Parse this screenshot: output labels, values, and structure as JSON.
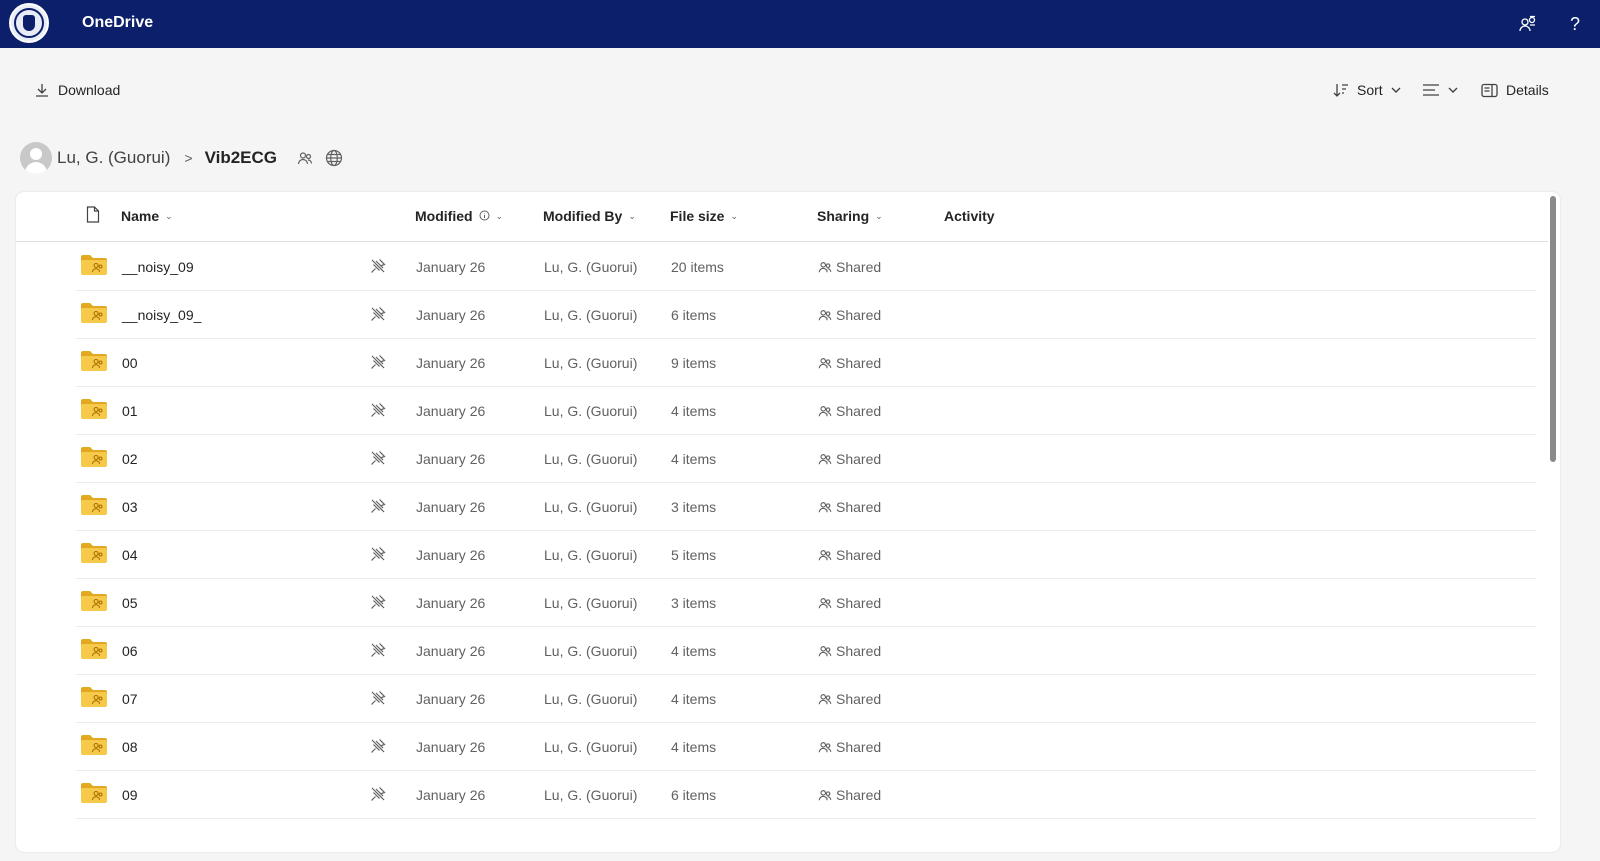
{
  "app": {
    "title": "OneDrive",
    "logo_icon": "university-seal-icon",
    "header_icons": [
      "people-settings-icon",
      "help-icon"
    ],
    "help_glyph": "?"
  },
  "toolbar": {
    "download_label": "Download",
    "sort_label": "Sort",
    "view_icon": "list-view-icon",
    "details_label": "Details"
  },
  "breadcrumb": {
    "owner": "Lu, G. (Guorui)",
    "separator": ">",
    "current": "Vib2ECG",
    "icons": [
      "shared-people-icon",
      "globe-icon"
    ]
  },
  "columns": {
    "name": "Name",
    "modified": "Modified",
    "modified_by": "Modified By",
    "file_size": "File size",
    "sharing": "Sharing",
    "activity": "Activity"
  },
  "colors": {
    "header_bg": "#0b1f6a",
    "folder_yellow": "#f7c948",
    "folder_dark": "#e2a81f"
  },
  "rows": [
    {
      "name": "__noisy_09",
      "modified": "January 26",
      "modified_by": "Lu, G. (Guorui)",
      "size": "20 items",
      "sharing": "Shared"
    },
    {
      "name": "__noisy_09_",
      "modified": "January 26",
      "modified_by": "Lu, G. (Guorui)",
      "size": "6 items",
      "sharing": "Shared"
    },
    {
      "name": "00",
      "modified": "January 26",
      "modified_by": "Lu, G. (Guorui)",
      "size": "9 items",
      "sharing": "Shared"
    },
    {
      "name": "01",
      "modified": "January 26",
      "modified_by": "Lu, G. (Guorui)",
      "size": "4 items",
      "sharing": "Shared"
    },
    {
      "name": "02",
      "modified": "January 26",
      "modified_by": "Lu, G. (Guorui)",
      "size": "4 items",
      "sharing": "Shared"
    },
    {
      "name": "03",
      "modified": "January 26",
      "modified_by": "Lu, G. (Guorui)",
      "size": "3 items",
      "sharing": "Shared"
    },
    {
      "name": "04",
      "modified": "January 26",
      "modified_by": "Lu, G. (Guorui)",
      "size": "5 items",
      "sharing": "Shared"
    },
    {
      "name": "05",
      "modified": "January 26",
      "modified_by": "Lu, G. (Guorui)",
      "size": "3 items",
      "sharing": "Shared"
    },
    {
      "name": "06",
      "modified": "January 26",
      "modified_by": "Lu, G. (Guorui)",
      "size": "4 items",
      "sharing": "Shared"
    },
    {
      "name": "07",
      "modified": "January 26",
      "modified_by": "Lu, G. (Guorui)",
      "size": "4 items",
      "sharing": "Shared"
    },
    {
      "name": "08",
      "modified": "January 26",
      "modified_by": "Lu, G. (Guorui)",
      "size": "4 items",
      "sharing": "Shared"
    },
    {
      "name": "09",
      "modified": "January 26",
      "modified_by": "Lu, G. (Guorui)",
      "size": "6 items",
      "sharing": "Shared"
    }
  ]
}
